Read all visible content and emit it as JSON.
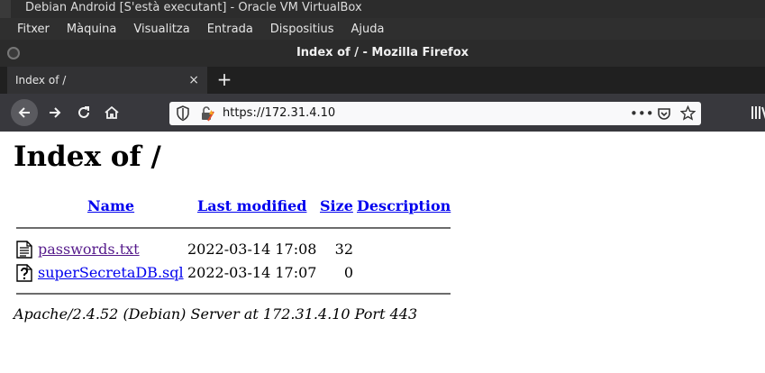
{
  "vbox": {
    "title": "Debian Android [S'està executant] - Oracle VM VirtualBox",
    "menu": [
      "Fitxer",
      "Màquina",
      "Visualitza",
      "Entrada",
      "Dispositius",
      "Ajuda"
    ]
  },
  "firefox": {
    "window_title": "Index of / - Mozilla Firefox",
    "tab": {
      "title": "Index of /",
      "close": "×"
    },
    "new_tab": "+",
    "url": "https://172.31.4.10",
    "icons": {
      "back": "arrow-left-icon",
      "forward": "arrow-right-icon",
      "reload": "reload-icon",
      "home": "home-icon",
      "more": "page-actions-icon",
      "pocket": "pocket-icon",
      "bookmark": "star-icon",
      "library": "library-icon"
    },
    "accent": "#38383d"
  },
  "page": {
    "heading": "Index of /",
    "columns": {
      "name": "Name",
      "modified": "Last modified",
      "size": "Size",
      "description": "Description"
    },
    "files": [
      {
        "name": "passwords.txt",
        "modified": "2022-03-14 17:08",
        "size": "32",
        "icon": "text-file-icon",
        "visited": true
      },
      {
        "name": "superSecretaDB.sql",
        "modified": "2022-03-14 17:07",
        "size": "0",
        "icon": "unknown-file-icon",
        "visited": false
      }
    ],
    "address": "Apache/2.4.52 (Debian) Server at 172.31.4.10 Port 443",
    "link_color": "#0000ee",
    "visited_color": "#551a8b"
  }
}
